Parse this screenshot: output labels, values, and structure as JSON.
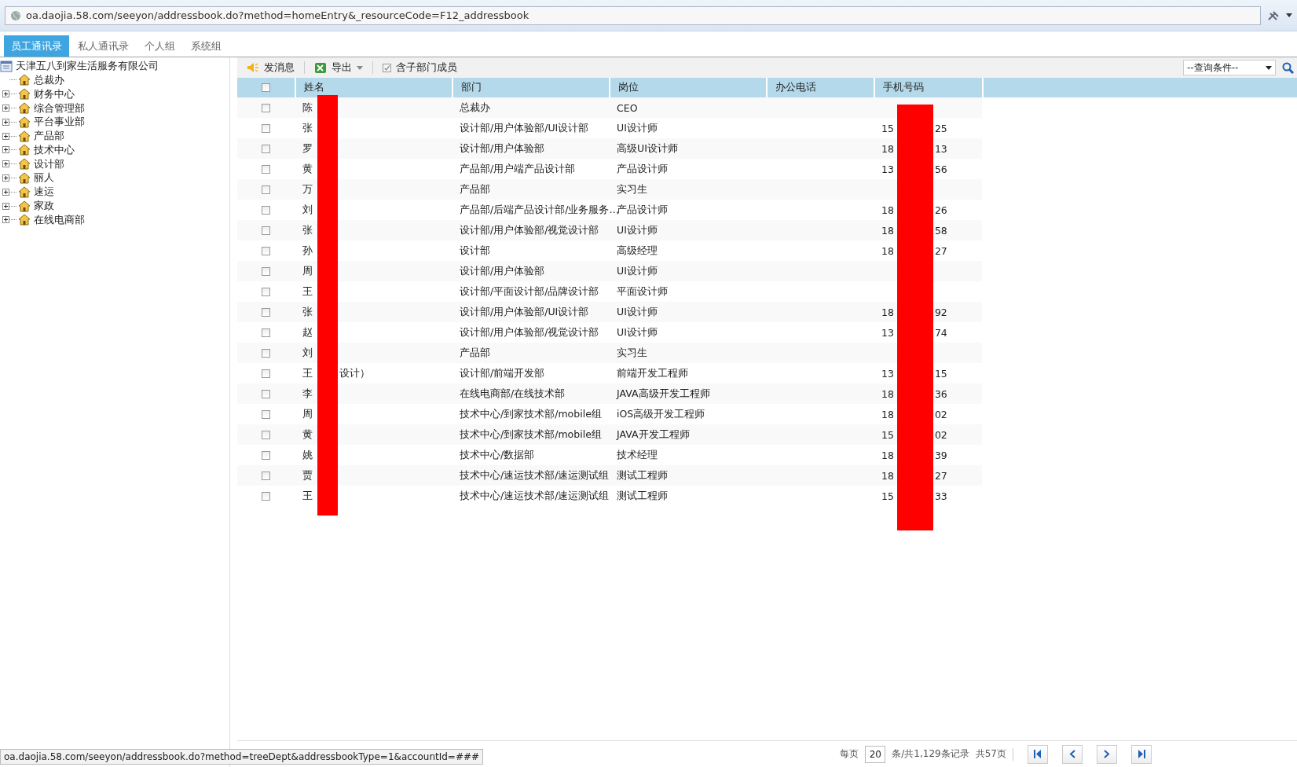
{
  "address_bar": {
    "url": "oa.daojia.58.com/seeyon/addressbook.do?method=homeEntry&_resourceCode=F12_addressbook"
  },
  "tabs": [
    {
      "label": "员工通讯录",
      "selected": true
    },
    {
      "label": "私人通讯录",
      "selected": false
    },
    {
      "label": "个人组",
      "selected": false
    },
    {
      "label": "系统组",
      "selected": false
    }
  ],
  "tree": {
    "root": "天津五八到家生活服务有限公司",
    "children": [
      {
        "label": "总裁办",
        "expandable": false
      },
      {
        "label": "财务中心",
        "expandable": true
      },
      {
        "label": "综合管理部",
        "expandable": true
      },
      {
        "label": "平台事业部",
        "expandable": true
      },
      {
        "label": "产品部",
        "expandable": true
      },
      {
        "label": "技术中心",
        "expandable": true
      },
      {
        "label": "设计部",
        "expandable": true
      },
      {
        "label": "丽人",
        "expandable": true
      },
      {
        "label": "速运",
        "expandable": true
      },
      {
        "label": "家政",
        "expandable": true
      },
      {
        "label": "在线电商部",
        "expandable": true
      }
    ]
  },
  "toolbar": {
    "send_message": "发消息",
    "export": "导出",
    "include_sub": {
      "label": "含子部门成员",
      "checked": true
    },
    "query_select": "--查询条件--"
  },
  "table": {
    "columns": [
      "姓名",
      "部门",
      "岗位",
      "办公电话",
      "手机号码"
    ],
    "select_all_checked": false,
    "rows": [
      {
        "checked": false,
        "name_start": "陈",
        "dept": "总裁办",
        "post": "CEO"
      },
      {
        "checked": false,
        "name_start": "张",
        "dept": "设计部/用户体验部/UI设计部",
        "post": "UI设计师",
        "phone_start": "15",
        "phone_end": "25"
      },
      {
        "checked": false,
        "name_start": "罗",
        "dept": "设计部/用户体验部",
        "post": "高级UI设计师",
        "phone_start": "18",
        "phone_end": "13"
      },
      {
        "checked": false,
        "name_start": "黄",
        "dept": "产品部/用户端产品设计部",
        "post": "产品设计师",
        "phone_start": "13",
        "phone_end": "56"
      },
      {
        "checked": false,
        "name_start": "万",
        "dept": "产品部",
        "post": "实习生"
      },
      {
        "checked": false,
        "name_start": "刘",
        "dept": "产品部/后端产品设计部/业务服务…",
        "post": "产品设计师",
        "phone_start": "18",
        "phone_end": "26"
      },
      {
        "checked": false,
        "name_start": "张",
        "dept": "设计部/用户体验部/视觉设计部",
        "post": "UI设计师",
        "phone_start": "18",
        "phone_end": "58"
      },
      {
        "checked": false,
        "name_start": "孙",
        "dept": "设计部",
        "post": "高级经理",
        "phone_start": "18",
        "phone_end": "27"
      },
      {
        "checked": false,
        "name_start": "周",
        "dept": "设计部/用户体验部",
        "post": "UI设计师"
      },
      {
        "checked": false,
        "name_start": "王",
        "dept": "设计部/平面设计部/品牌设计部",
        "post": "平面设计师"
      },
      {
        "checked": false,
        "name_start": "张",
        "dept": "设计部/用户体验部/UI设计部",
        "post": "UI设计师",
        "phone_start": "18",
        "phone_end": "92"
      },
      {
        "checked": false,
        "name_start": "赵",
        "dept": "设计部/用户体验部/视觉设计部",
        "post": "UI设计师",
        "phone_start": "13",
        "phone_end": "74"
      },
      {
        "checked": false,
        "name_start": "刘",
        "dept": "产品部",
        "post": "实习生"
      },
      {
        "checked": false,
        "name_start": "王",
        "name_end": "设计）",
        "dept": "设计部/前端开发部",
        "post": "前端开发工程师",
        "phone_start": "13",
        "phone_end": "15"
      },
      {
        "checked": false,
        "name_start": "李",
        "dept": "在线电商部/在线技术部",
        "post": "JAVA高级开发工程师",
        "phone_start": "18",
        "phone_end": "36"
      },
      {
        "checked": false,
        "name_start": "周",
        "dept": "技术中心/到家技术部/mobile组",
        "post": "iOS高级开发工程师",
        "phone_start": "18",
        "phone_end": "02"
      },
      {
        "checked": false,
        "name_start": "黄",
        "dept": "技术中心/到家技术部/mobile组",
        "post": "JAVA开发工程师",
        "phone_start": "15",
        "phone_end": "02"
      },
      {
        "checked": false,
        "name_start": "姚",
        "dept": "技术中心/数据部",
        "post": "技术经理",
        "phone_start": "18",
        "phone_end": "39"
      },
      {
        "checked": false,
        "name_start": "贾",
        "dept": "技术中心/速运技术部/速运测试组",
        "post": "测试工程师",
        "phone_start": "18",
        "phone_end": "27"
      },
      {
        "checked": false,
        "name_start": "王",
        "dept": "技术中心/速运技术部/速运测试组",
        "post": "测试工程师",
        "phone_start": "15",
        "phone_end": "33"
      }
    ]
  },
  "pager": {
    "per_page_label": "每页",
    "per_page": "20",
    "records": "条/共1,129条记录",
    "pages": "共57页"
  },
  "status_link": "oa.daojia.58.com/seeyon/addressbook.do?method=treeDept&addressbookType=1&accountId=###"
}
